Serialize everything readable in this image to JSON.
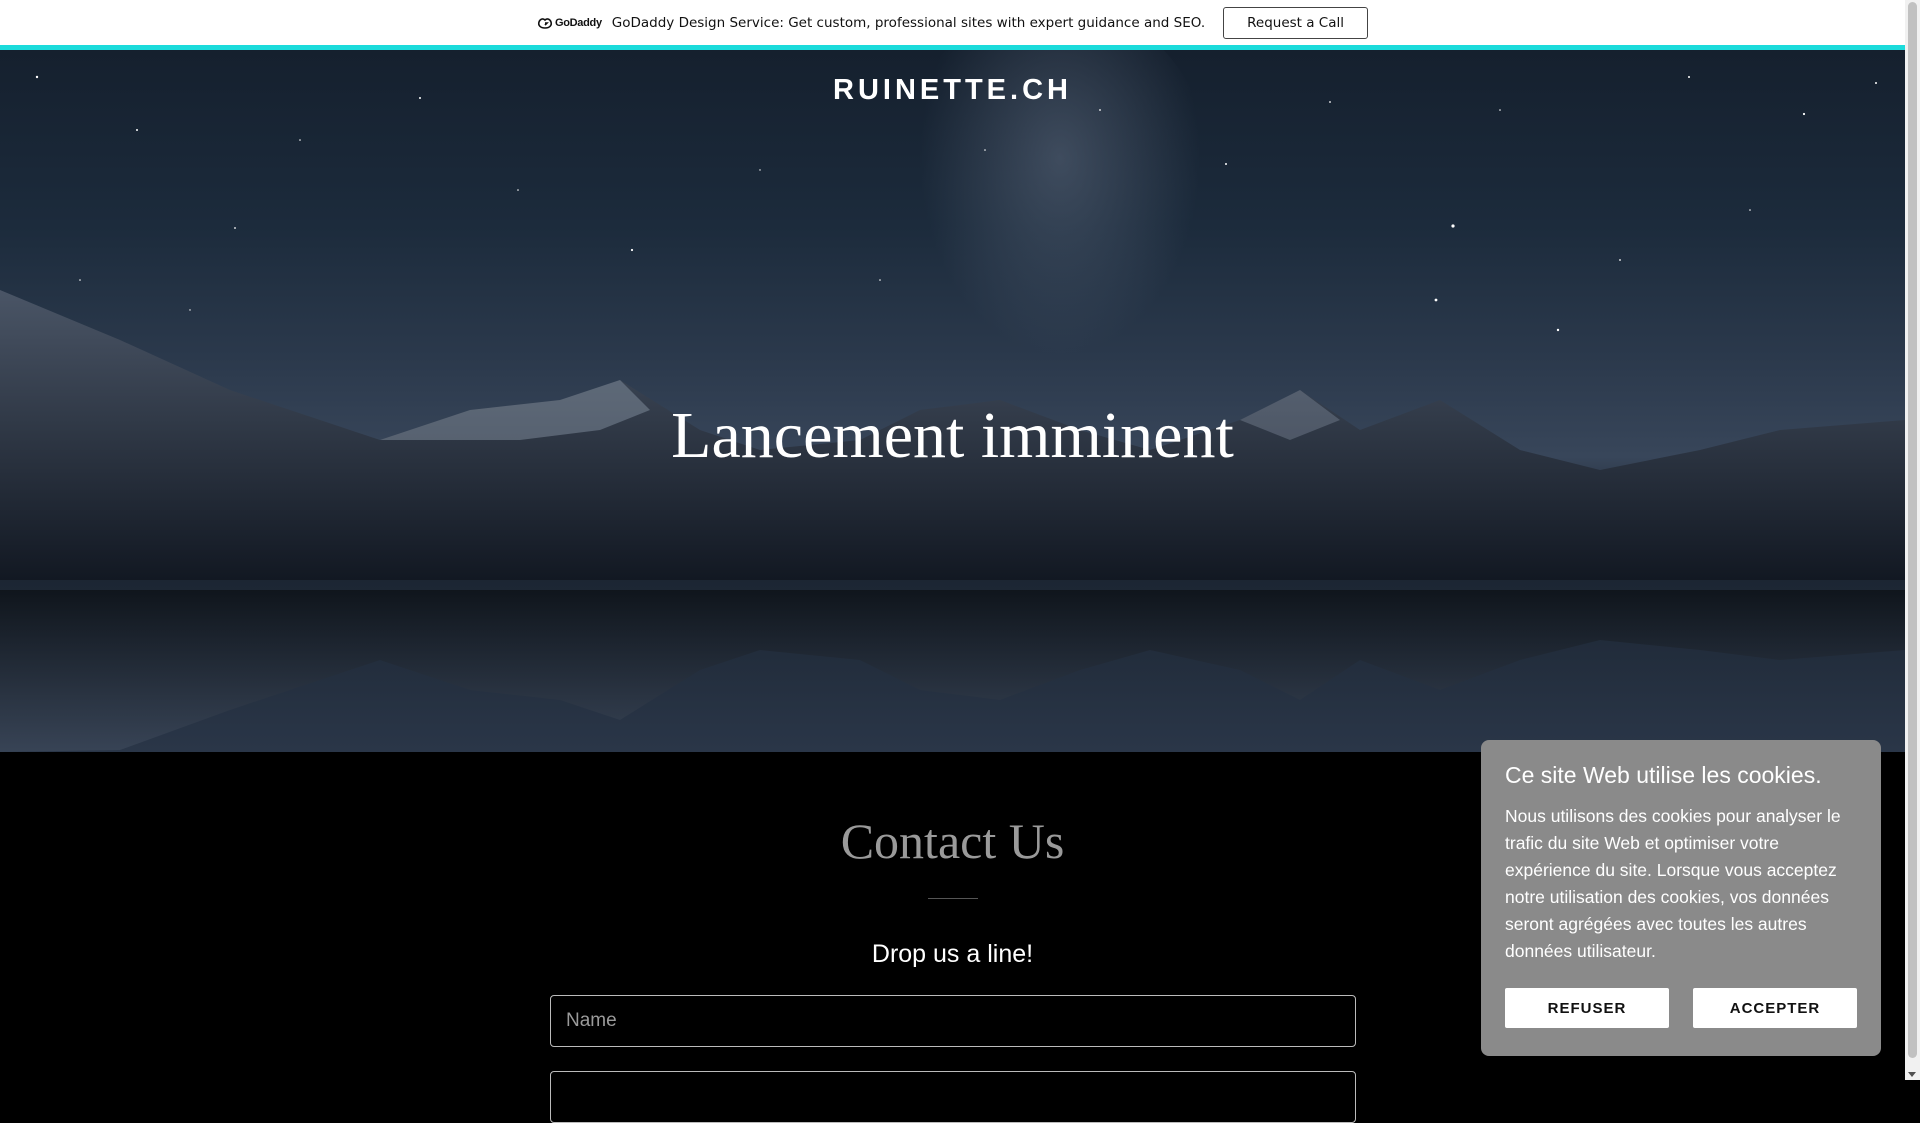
{
  "promo": {
    "logo_text": "GoDaddy",
    "message": "GoDaddy Design Service: Get custom, professional sites with expert guidance and SEO.",
    "cta_label": "Request a Call",
    "accent_color": "#1bdbdb"
  },
  "header": {
    "site_title": "RUINETTE.CH"
  },
  "hero": {
    "heading": "Lancement imminent"
  },
  "contact": {
    "title": "Contact Us",
    "subtitle": "Drop us a line!",
    "name_placeholder": "Name"
  },
  "cookie": {
    "title": "Ce site Web utilise les cookies.",
    "body": "Nous utilisons des cookies pour analyser le trafic du site Web et optimiser votre expérience du site. Lorsque vous acceptez notre utilisation des cookies, vos données seront agrégées avec toutes les autres données utilisateur.",
    "decline_label": "REFUSER",
    "accept_label": "ACCEPTER",
    "background_color": "#8a8a8a"
  }
}
